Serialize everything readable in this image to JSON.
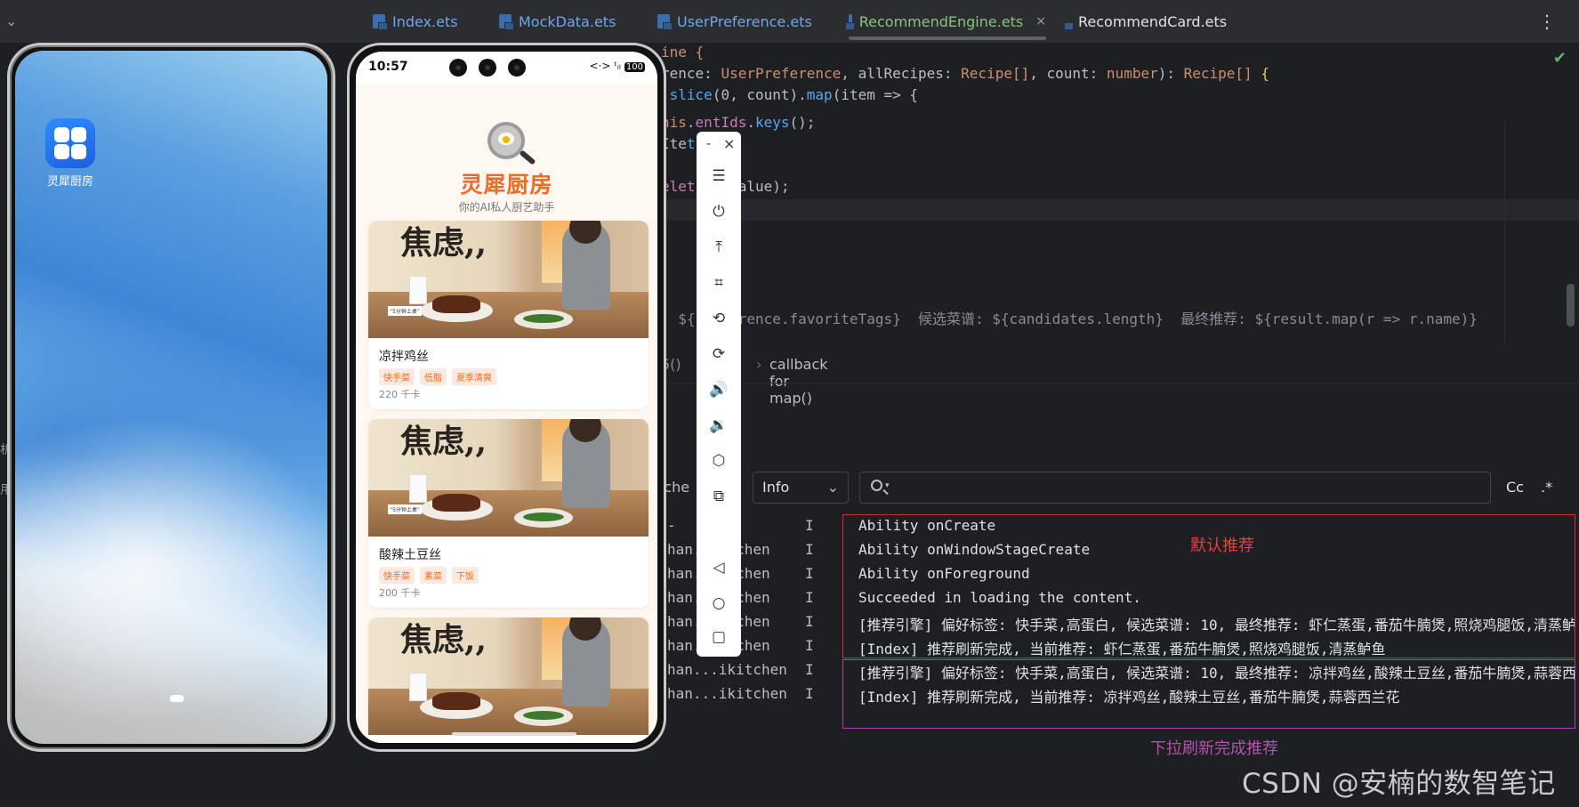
{
  "ide": {
    "tabs": [
      {
        "label": "Index.ets",
        "active": false
      },
      {
        "label": "MockData.ets",
        "active": false
      },
      {
        "label": "UserPreference.ets",
        "active": false
      },
      {
        "label": "RecommendEngine.ets",
        "active": true,
        "close": "×"
      },
      {
        "label": "RecommendCard.ets",
        "active": false
      }
    ],
    "code_lines": [
      {
        "text": "ine {"
      },
      {
        "a": "rence: ",
        "b": "UserPreference",
        "c": ", allRecipes: ",
        "d": "Recipe[]",
        "e": ", count: ",
        "f": "number",
        "g": "): ",
        "h": "Recipe[]",
        "i": " {"
      },
      {
        "a": ".",
        "b": "slice",
        "c": "(0, count).",
        "d": "map",
        "e": "(item => {"
      },
      {
        "a": "his",
        "b": ".",
        "c": "entIds",
        "d": ".",
        "e": "keys",
        "f": "();"
      },
      {
        "a": "Ite",
        "b": "t",
        "c": "();"
      },
      {
        "a": "elet",
        "b": "rst.value);"
      },
      {
        "text": "  ${preference.favoriteTags}  候选菜谱: ${candidates.length}  最终推荐: ${result.map(r => r.name)}"
      }
    ],
    "breadcrumb": {
      "left": "5()",
      "chevron": "›",
      "text": "callback for map()"
    },
    "log": {
      "filter_fragment": "tche",
      "level": "Info",
      "search_placeholder": "",
      "case_label": "Cc",
      "regex_label": ".*",
      "rows": [
        {
          "pid": "",
          "tag": "-",
          "level": "I",
          "msg": "Ability onCreate"
        },
        {
          "pid": "",
          "tag": "han...itchen",
          "level": "I",
          "msg": "Ability onWindowStageCreate"
        },
        {
          "pid": "",
          "tag": "han...itchen",
          "level": "I",
          "msg": "Ability onForeground"
        },
        {
          "pid": "",
          "tag": "han...itchen",
          "level": "I",
          "msg": "Succeeded in loading the content."
        },
        {
          "pid": "",
          "tag": "han...itchen",
          "level": "I",
          "msg": "[推荐引擎] 偏好标签: 快手菜,高蛋白, 候选菜谱: 10, 最终推荐: 虾仁蒸蛋,番茄牛腩煲,照烧鸡腿饭,清蒸鲈"
        },
        {
          "pid": "",
          "tag": "han...itchen",
          "level": "I",
          "msg": "[Index] 推荐刷新完成, 当前推荐: 虾仁蒸蛋,番茄牛腩煲,照烧鸡腿饭,清蒸鲈鱼"
        },
        {
          "pid": "",
          "tag": "han...ikitchen",
          "level": "I",
          "msg": "[推荐引擎] 偏好标签: 快手菜,高蛋白, 候选菜谱: 10, 最终推荐: 凉拌鸡丝,酸辣土豆丝,番茄牛腩煲,蒜蓉西"
        },
        {
          "pid": "",
          "tag": "han...ikitchen",
          "level": "I",
          "msg": "[Index] 推荐刷新完成, 当前推荐: 凉拌鸡丝,酸辣土豆丝,番茄牛腩煲,蒜蓉西兰花"
        }
      ]
    },
    "annotations": {
      "default_label": "默认推荐",
      "refresh_label": "下拉刷新完成推荐"
    },
    "watermark": "CSDN @安楠的数智笔记",
    "gutter": {
      "frag1": "析",
      "frag2": "用"
    }
  },
  "home": {
    "app_label": "灵犀厨房"
  },
  "app": {
    "status": {
      "time": "10:57",
      "icons": "<·> ᵗᵢₗ",
      "battery": "100"
    },
    "title": "灵犀厨房",
    "subtitle": "你的AI私人厨艺助手",
    "cards": [
      {
        "name": "凉拌鸡丝",
        "tags": [
          "快手菜",
          "低脂",
          "夏季清爽"
        ],
        "calories": "220 千卡",
        "img_text": "焦虑,,",
        "img_note": "“5分钟上桌”"
      },
      {
        "name": "酸辣土豆丝",
        "tags": [
          "快手菜",
          "素菜",
          "下饭"
        ],
        "calories": "200 千卡",
        "img_text": "焦虑,,",
        "img_note": "“5分钟上桌”"
      },
      {
        "name": "",
        "tags": [],
        "calories": "",
        "img_text": "焦虑,,",
        "img_note": ""
      }
    ]
  },
  "emulator_toolbar": {
    "minimize": "-",
    "close": "×",
    "buttons": [
      {
        "name": "menu-icon",
        "glyph": "☰"
      },
      {
        "name": "power-icon",
        "glyph": "⏻"
      },
      {
        "name": "upload-icon",
        "glyph": "⤒"
      },
      {
        "name": "crop-icon",
        "glyph": "⌗"
      },
      {
        "name": "rotate-left-icon",
        "glyph": "⟲"
      },
      {
        "name": "rotate-right-icon",
        "glyph": "⟳"
      },
      {
        "name": "volume-up-icon",
        "glyph": "🔊"
      },
      {
        "name": "volume-down-icon",
        "glyph": "🔉"
      },
      {
        "name": "shake-icon",
        "glyph": "⬡"
      },
      {
        "name": "multi-screen-icon",
        "glyph": "⧉"
      },
      {
        "name": "back-icon",
        "glyph": "◁"
      },
      {
        "name": "home-icon",
        "glyph": "○"
      },
      {
        "name": "recents-icon",
        "glyph": "▢"
      }
    ]
  }
}
